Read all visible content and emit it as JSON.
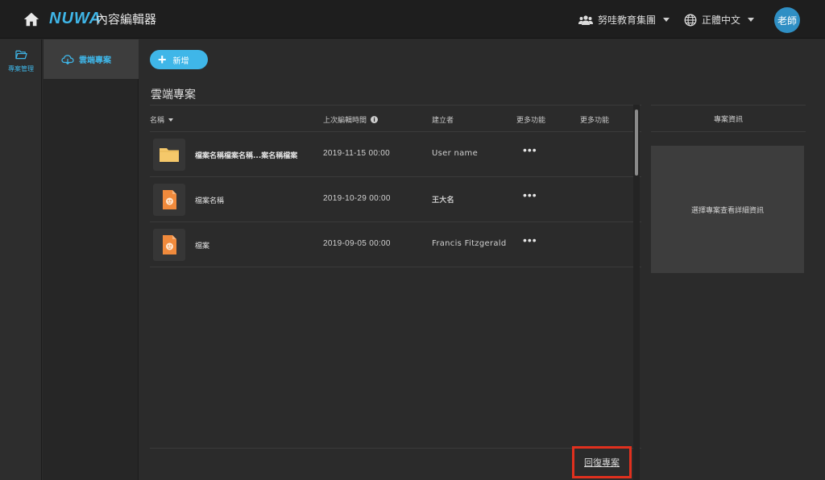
{
  "header": {
    "logo_text": "NUWA",
    "app_title": "內容編輯器",
    "team_name": "努哇教育集團",
    "language": "正體中文",
    "avatar_text": "老師"
  },
  "rail": {
    "items": [
      {
        "label": "專案管理",
        "icon": "folder-open-icon"
      }
    ]
  },
  "subnav": {
    "items": [
      {
        "label": "雲端專案",
        "icon": "cloud-icon",
        "active": true
      }
    ]
  },
  "toolbar": {
    "new_label": "新增"
  },
  "main": {
    "section_title": "雲端專案",
    "columns": {
      "name": "名稱",
      "last_edit": "上次編輯時間",
      "creator": "建立者",
      "more1": "更多功能",
      "more2": "更多功能"
    },
    "rows": [
      {
        "name": "檔案名稱檔案名稱...案名稱檔案",
        "time": "2019-11-15  00:00",
        "creator": "User name",
        "more": "•••",
        "icon": "folder-icon"
      },
      {
        "name": "檔案名稱",
        "time": "2019-10-29  00:00",
        "creator": "王大名",
        "more": "•••",
        "icon": "file-icon"
      },
      {
        "name": "檔案",
        "time": "2019-09-05  00:00",
        "creator": "Francis Fitzgerald",
        "more": "•••",
        "icon": "file-icon"
      }
    ],
    "restore_label": "回復專案"
  },
  "info_panel": {
    "title": "專案資訊",
    "placeholder": "選擇專案查看詳細資訊"
  },
  "colors": {
    "accent": "#3fb6e8",
    "folder": "#f5c86a",
    "file": "#f08a3c",
    "highlight_border": "#e0301e"
  }
}
